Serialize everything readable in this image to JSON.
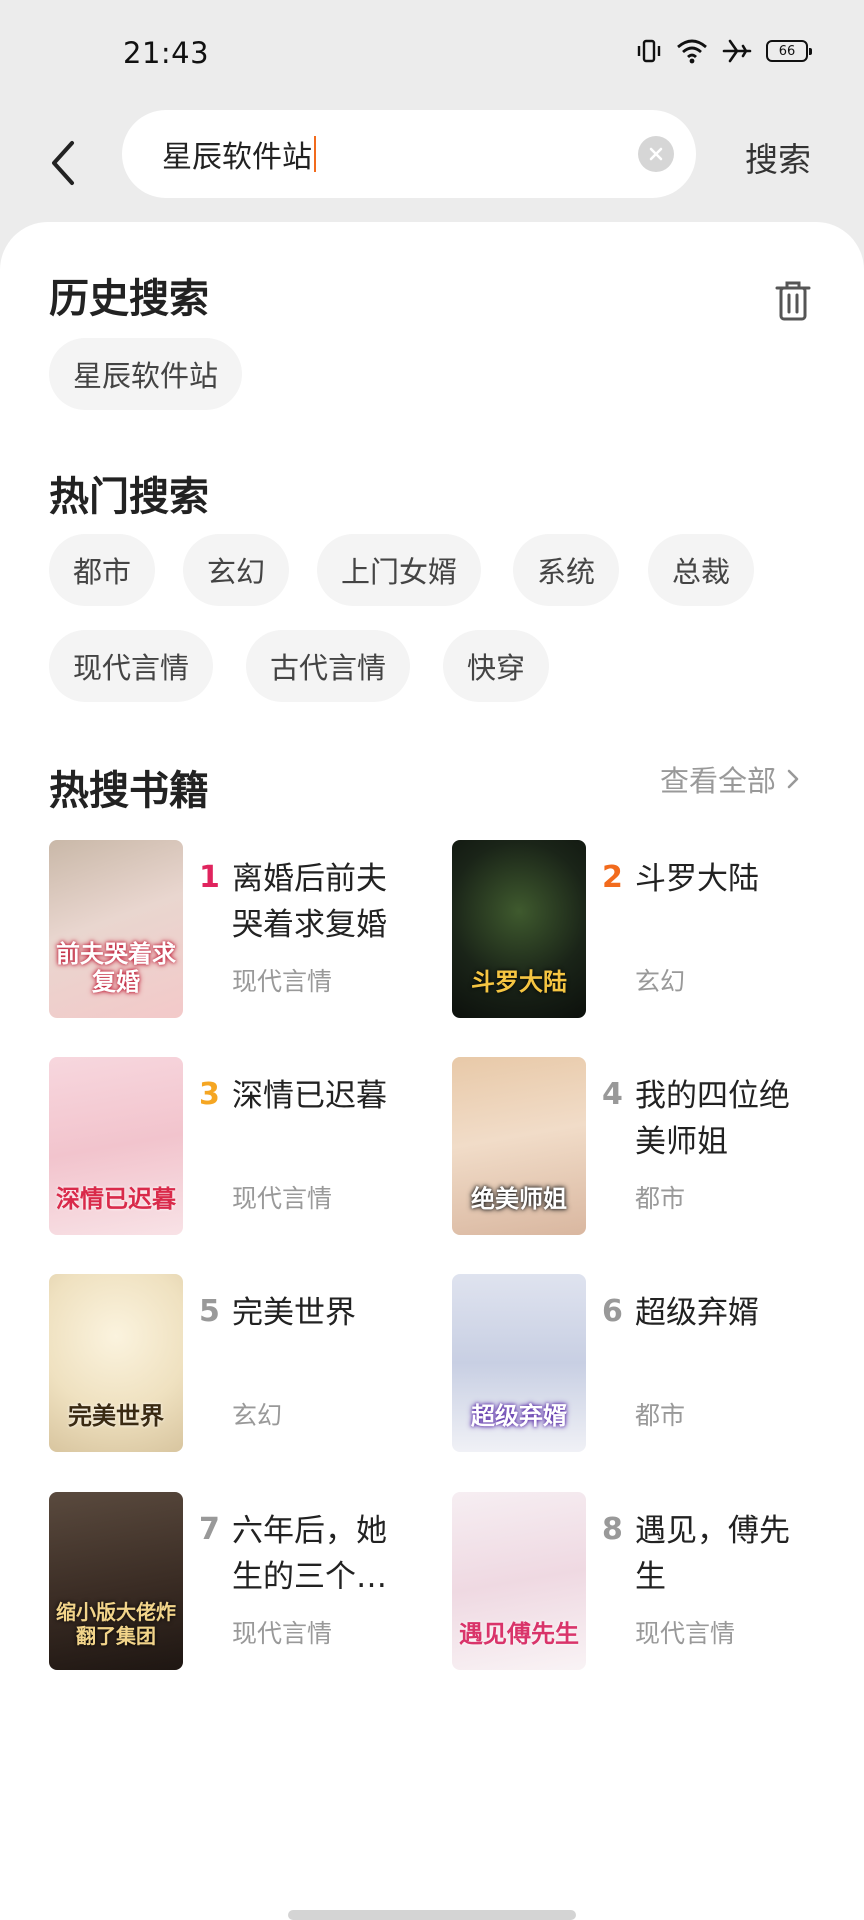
{
  "status_bar": {
    "time": "21:43",
    "battery": "66"
  },
  "search": {
    "query": "星辰软件站",
    "button_label": "搜索"
  },
  "history": {
    "title": "历史搜索",
    "items": [
      "星辰软件站"
    ]
  },
  "hot_search": {
    "title": "热门搜索",
    "tags": [
      "都市",
      "玄幻",
      "上门女婿",
      "系统",
      "总裁",
      "现代言情",
      "古代言情",
      "快穿"
    ]
  },
  "hot_books": {
    "title": "热搜书籍",
    "view_all": "查看全部",
    "books": [
      {
        "rank": "1",
        "title": "离婚后前夫哭着求复婚",
        "genre": "现代言情",
        "cover_text": "前夫哭着求复婚",
        "rank_color": "#e0245e"
      },
      {
        "rank": "2",
        "title": "斗罗大陆",
        "genre": "玄幻",
        "cover_text": "斗罗大陆",
        "rank_color": "#f26b1d"
      },
      {
        "rank": "3",
        "title": "深情已迟暮",
        "genre": "现代言情",
        "cover_text": "深情已迟暮",
        "rank_color": "#f5a623"
      },
      {
        "rank": "4",
        "title": "我的四位绝美师姐",
        "genre": "都市",
        "cover_text": "绝美师姐",
        "rank_color": "#999999"
      },
      {
        "rank": "5",
        "title": "完美世界",
        "genre": "玄幻",
        "cover_text": "完美世界",
        "rank_color": "#999999"
      },
      {
        "rank": "6",
        "title": "超级弃婿",
        "genre": "都市",
        "cover_text": "超级弃婿",
        "rank_color": "#999999"
      },
      {
        "rank": "7",
        "title": "六年后，她生的三个…",
        "genre": "现代言情",
        "cover_text": "缩小版大佬炸翻了集团",
        "rank_color": "#999999"
      },
      {
        "rank": "8",
        "title": "遇见，傅先生",
        "genre": "现代言情",
        "cover_text": "遇见傅先生",
        "rank_color": "#999999"
      }
    ]
  }
}
